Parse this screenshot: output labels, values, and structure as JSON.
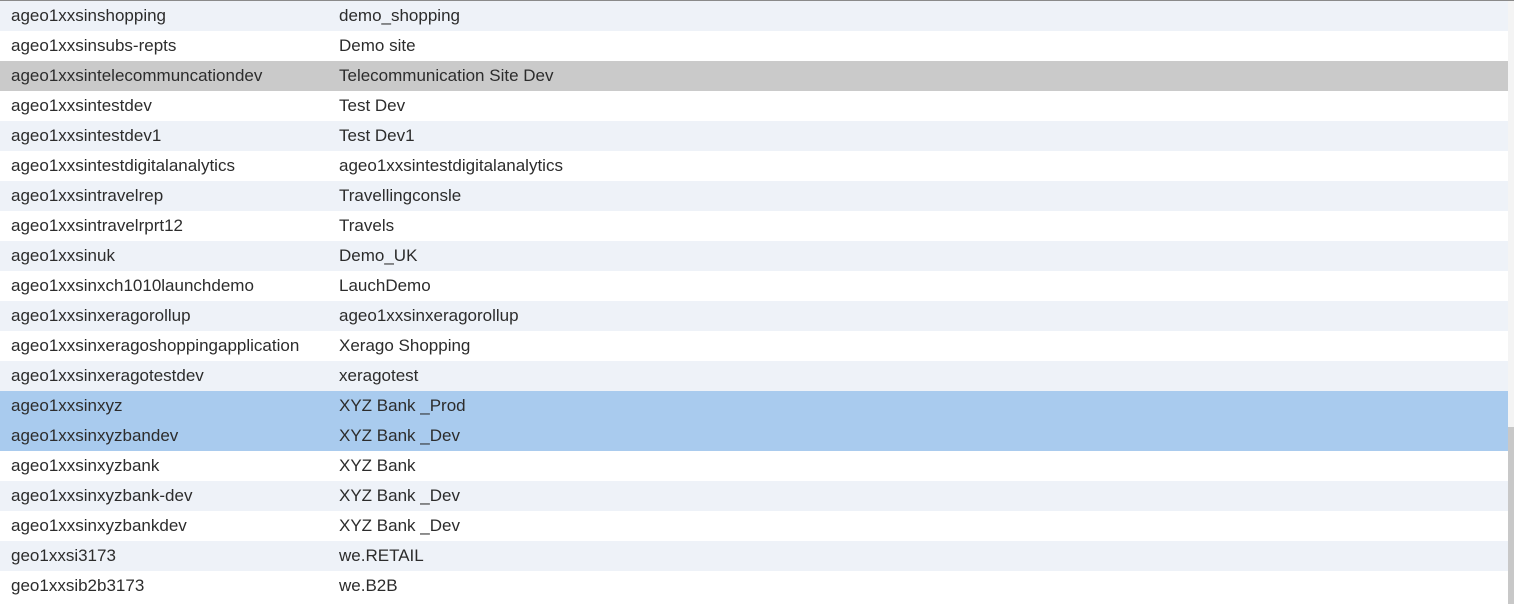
{
  "rows": [
    {
      "id": "ageo1xxsinshopping",
      "name": "demo_shopping",
      "state": "alt"
    },
    {
      "id": "ageo1xxsinsubs-repts",
      "name": "Demo site",
      "state": "plain"
    },
    {
      "id": "ageo1xxsintelecommuncationdev",
      "name": "Telecommunication Site Dev",
      "state": "hover"
    },
    {
      "id": "ageo1xxsintestdev",
      "name": "Test Dev",
      "state": "plain"
    },
    {
      "id": "ageo1xxsintestdev1",
      "name": "Test Dev1",
      "state": "alt"
    },
    {
      "id": "ageo1xxsintestdigitalanalytics",
      "name": "ageo1xxsintestdigitalanalytics",
      "state": "plain"
    },
    {
      "id": "ageo1xxsintravelrep",
      "name": "Travellingconsle",
      "state": "alt"
    },
    {
      "id": "ageo1xxsintravelrprt12",
      "name": "Travels",
      "state": "plain"
    },
    {
      "id": "ageo1xxsinuk",
      "name": "Demo_UK",
      "state": "alt"
    },
    {
      "id": "ageo1xxsinxch1010launchdemo",
      "name": "LauchDemo",
      "state": "plain"
    },
    {
      "id": "ageo1xxsinxeragorollup",
      "name": "ageo1xxsinxeragorollup",
      "state": "alt"
    },
    {
      "id": "ageo1xxsinxeragoshoppingapplication",
      "name": "Xerago Shopping",
      "state": "plain"
    },
    {
      "id": "ageo1xxsinxeragotestdev",
      "name": "xeragotest",
      "state": "alt"
    },
    {
      "id": "ageo1xxsinxyz",
      "name": "XYZ Bank _Prod",
      "state": "selected"
    },
    {
      "id": "ageo1xxsinxyzbandev",
      "name": "XYZ Bank _Dev",
      "state": "selected"
    },
    {
      "id": "ageo1xxsinxyzbank",
      "name": "XYZ Bank",
      "state": "plain"
    },
    {
      "id": "ageo1xxsinxyzbank-dev",
      "name": "XYZ Bank _Dev",
      "state": "alt"
    },
    {
      "id": "ageo1xxsinxyzbankdev",
      "name": "XYZ Bank _Dev",
      "state": "plain"
    },
    {
      "id": "geo1xxsi3173",
      "name": "we.RETAIL",
      "state": "alt"
    },
    {
      "id": "geo1xxsib2b3173",
      "name": "we.B2B",
      "state": "plain"
    }
  ],
  "colors": {
    "row_alt": "#eef2f8",
    "row_plain": "#ffffff",
    "row_hover": "#cacaca",
    "row_selected": "#a9cbee",
    "text": "#2c2c2c"
  }
}
